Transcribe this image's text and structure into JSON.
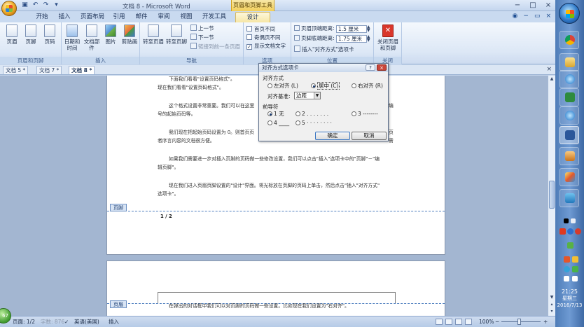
{
  "window": {
    "title": "文档 8 - Microsoft Word",
    "context_tab_title": "页眉和页脚工具",
    "buttons": [
      "−",
      "□",
      "×"
    ]
  },
  "quick_access": [
    "save-icon",
    "undo-icon",
    "redo-icon",
    "customize-icon"
  ],
  "tabs": [
    {
      "label": "开始"
    },
    {
      "label": "插入"
    },
    {
      "label": "页面布局"
    },
    {
      "label": "引用"
    },
    {
      "label": "邮件"
    },
    {
      "label": "审阅"
    },
    {
      "label": "视图"
    },
    {
      "label": "开发工具"
    },
    {
      "label": "设计"
    }
  ],
  "ribbon": {
    "groups": [
      {
        "label": "页眉和页脚",
        "buttons": [
          "页眉",
          "页脚",
          "页码"
        ]
      },
      {
        "label": "插入",
        "buttons": [
          "日期和时间",
          "文档部件",
          "图片",
          "剪贴画"
        ]
      },
      {
        "label": "导航",
        "buttons": [
          "转至页眉",
          "转至页脚"
        ],
        "small": [
          "上一节",
          "下一节",
          "链接到前一条页眉"
        ]
      },
      {
        "label": "选项",
        "checks": [
          {
            "label": "首页不同",
            "checked": false
          },
          {
            "label": "奇偶页不同",
            "checked": false
          },
          {
            "label": "显示文档文字",
            "checked": true
          }
        ]
      },
      {
        "label": "位置",
        "spins": [
          {
            "label": "页眉顶端距离:",
            "value": "1.5 厘米"
          },
          {
            "label": "页脚底端距离:",
            "value": "1.75 厘米"
          }
        ],
        "insert": "插入\"对齐方式\"选项卡"
      },
      {
        "label": "关闭",
        "buttons": [
          "关闭页眉和页脚"
        ]
      }
    ]
  },
  "doc_tabs": [
    "文档 5 *",
    "文档 7 *",
    "文档 8 *"
  ],
  "doc_tab_close": "×",
  "page1": {
    "paragraphs": [
      "下面我们看看\"设置页码格式\"。",
      "现在我们看看\"设置页码格式\"。",
      "这个格式设置非常重要。我们可以在这里",
      "号的起始页码等。",
      "我们现在把起始页码设置为 0。则首页页",
      "者序言内容的文档很方便。",
      "如果我们需要进一步对插入页脚的页码做一些修改设置，我们可以点击\"插入\"选项卡中的\"页脚\"－\"编",
      "辑页脚\"。",
      "现在我们进入页眉页脚设置的\"设计\"界面。将光标放在页脚的页码上单击，然后点击\"插入\"对齐方式\"",
      "选项卡\"。"
    ],
    "right_fragments": [
      "编",
      "页",
      "需"
    ],
    "footer_tag": "页脚",
    "footer_text": "1 / 2"
  },
  "page2": {
    "header_tag": "页眉",
    "text": "在弹出的对话框中我们可以对页脚的页码做一些设置。比如现在我们设置为\"右对齐\"。"
  },
  "dialog": {
    "title": "对齐方式选项卡",
    "title_buttons": [
      "?",
      "×"
    ],
    "section_align": "对齐方式",
    "align_options": [
      {
        "label": "左对齐 (L)",
        "selected": false
      },
      {
        "label": "居中 (C)",
        "selected": true
      },
      {
        "label": "右对齐 (R)",
        "selected": false
      }
    ],
    "align_base_label": "对齐基准:",
    "align_base_value": "边距",
    "section_leader": "前导符",
    "leader_options": [
      {
        "label": "1 无",
        "selected": true
      },
      {
        "label": "2 . . . . . . .",
        "selected": false
      },
      {
        "label": "3 --------",
        "selected": false
      },
      {
        "label": "4 ____",
        "selected": false
      },
      {
        "label": "5 · · · · · · · ·",
        "selected": false
      }
    ],
    "ok": "确定",
    "cancel": "取消"
  },
  "statusbar": {
    "page": "页面: 1/2",
    "words": "字数: 876",
    "language": "英语(美国)",
    "mode": "插入",
    "zoom": "100%",
    "zoom_minus": "−",
    "zoom_plus": "+"
  },
  "taskbar": {
    "apps": [
      "chrome-icon",
      "file-manager-icon",
      "ie-icon",
      "excel-icon",
      "ie-icon",
      "word-icon",
      "user-icon",
      "paint-icon",
      "media-icon"
    ],
    "time": "21:25",
    "weekday": "星期三",
    "date": "2016/7/13",
    "badge": "67"
  },
  "colors": {
    "accent": "#2b579a",
    "context_tab": "#f2cf5a",
    "close_button": "#d9362a"
  }
}
